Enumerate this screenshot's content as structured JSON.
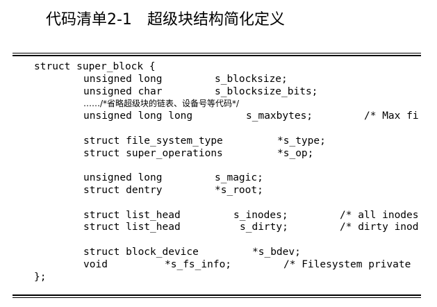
{
  "caption": {
    "number": "代码清单2-1",
    "title": "超级块结构简化定义"
  },
  "code": {
    "open": "struct super_block {",
    "l1_type": "unsigned long",
    "l1_name": "s_blocksize;",
    "l2_type": "unsigned char",
    "l2_name": "s_blocksize_bits;",
    "l3_comment": "……/*省略超级块的链表、设备号等代码*/",
    "l4_type": "unsigned long long",
    "l4_name": "s_maxbytes;",
    "l4_comment": "/* Max fi",
    "l5_type": "struct file_system_type",
    "l5_name": "*s_type;",
    "l6_type": "struct super_operations",
    "l6_name": "*s_op;",
    "l7_type": "unsigned long",
    "l7_name": "s_magic;",
    "l8_type": "struct dentry",
    "l8_name": "*s_root;",
    "l9_type": "struct list_head",
    "l9_name": "s_inodes;",
    "l9_comment": "/* all inodes",
    "l10_type": "struct list_head",
    "l10_name": "s_dirty;",
    "l10_comment": "/* dirty inod",
    "l11_type": "struct block_device",
    "l11_name": "*s_bdev;",
    "l12_type": "void",
    "l12_name": "*s_fs_info;",
    "l12_comment": "/* Filesystem private",
    "close": "};"
  }
}
